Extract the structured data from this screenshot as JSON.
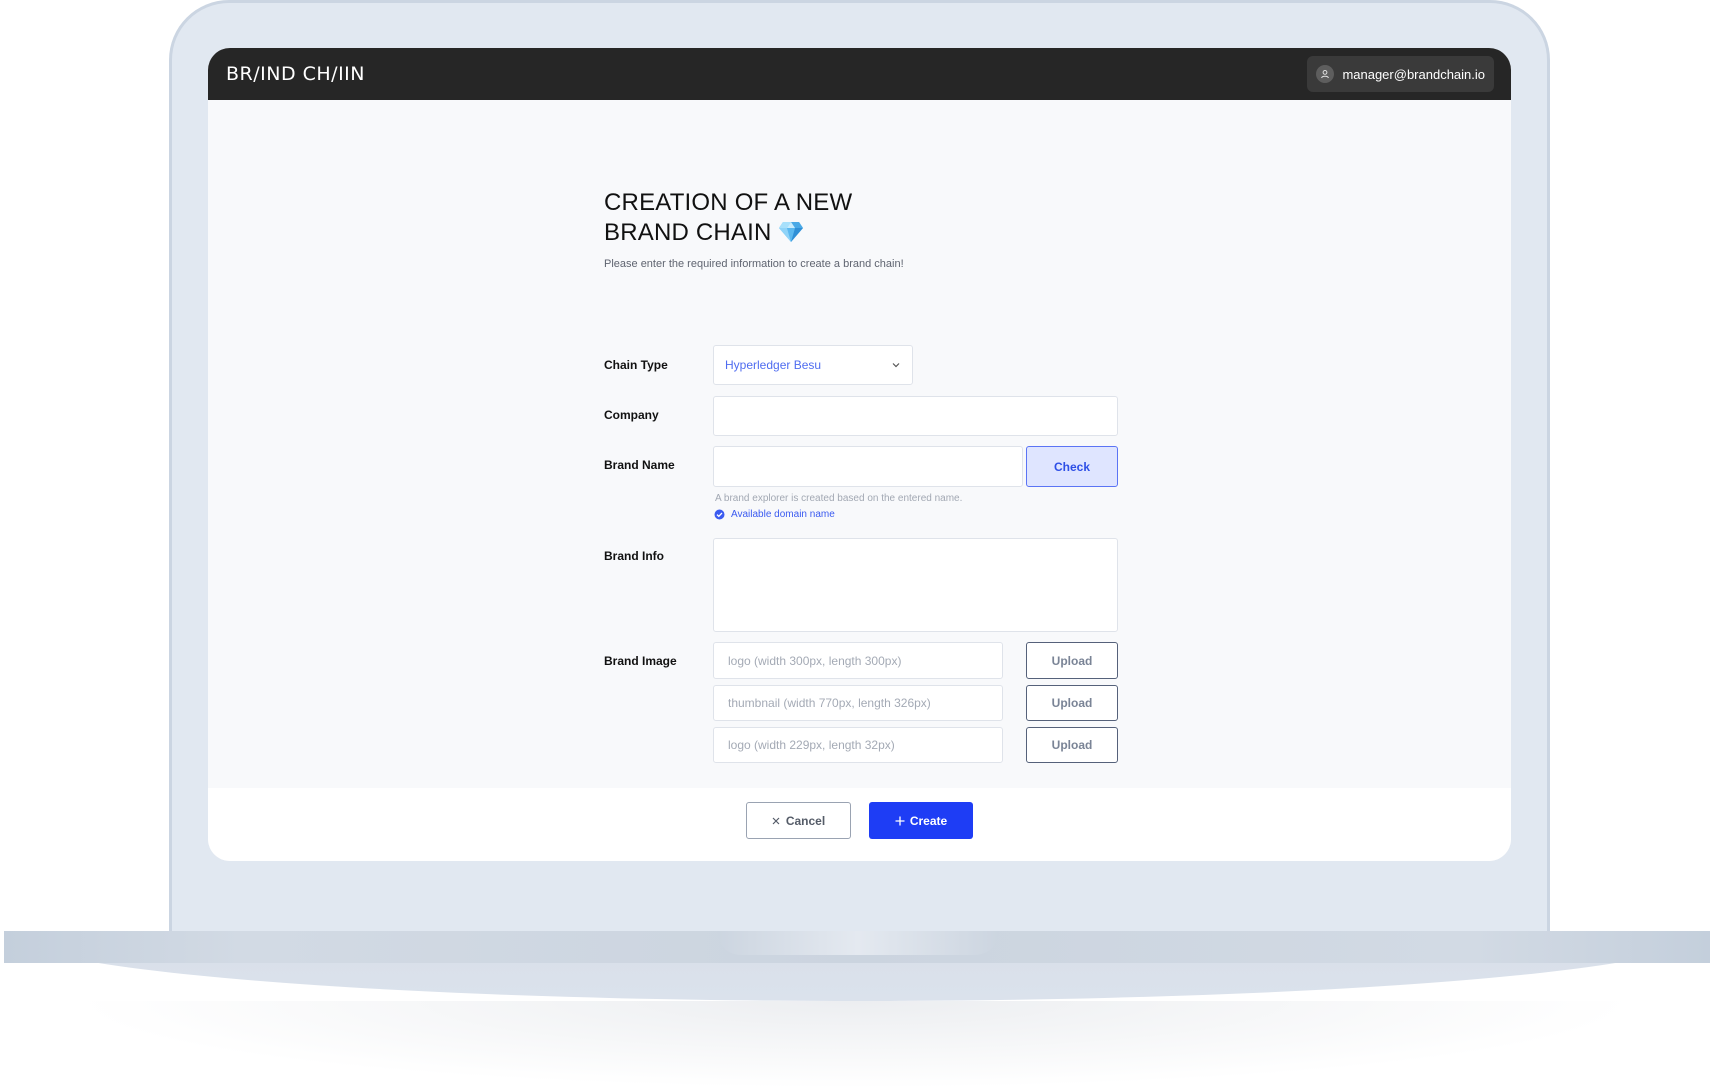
{
  "header": {
    "logo_text": "BR/IND CH/IIN",
    "account_email": "manager@brandchain.io"
  },
  "form": {
    "title_line1": "CREATION OF A NEW",
    "title_line2": "BRAND CHAIN",
    "subtitle": "Please enter the required information to create a brand chain!",
    "chain_type": {
      "label": "Chain Type",
      "value": "Hyperledger Besu"
    },
    "company": {
      "label": "Company",
      "value": ""
    },
    "brand_name": {
      "label": "Brand Name",
      "value": "",
      "check_label": "Check",
      "hint": "A brand explorer is created based on the entered name.",
      "status": "Available domain name"
    },
    "brand_info": {
      "label": "Brand Info",
      "value": ""
    },
    "brand_image": {
      "label": "Brand Image",
      "upload_label": "Upload",
      "placeholders": [
        "logo (width 300px, length 300px)",
        "thumbnail (width 770px, length 326px)",
        "logo (width 229px, length 32px)"
      ]
    }
  },
  "footer": {
    "cancel_label": "Cancel",
    "create_label": "Create"
  },
  "colors": {
    "accent": "#1e3df5",
    "topbar": "#262626",
    "check_bg": "#dfe5ff"
  }
}
